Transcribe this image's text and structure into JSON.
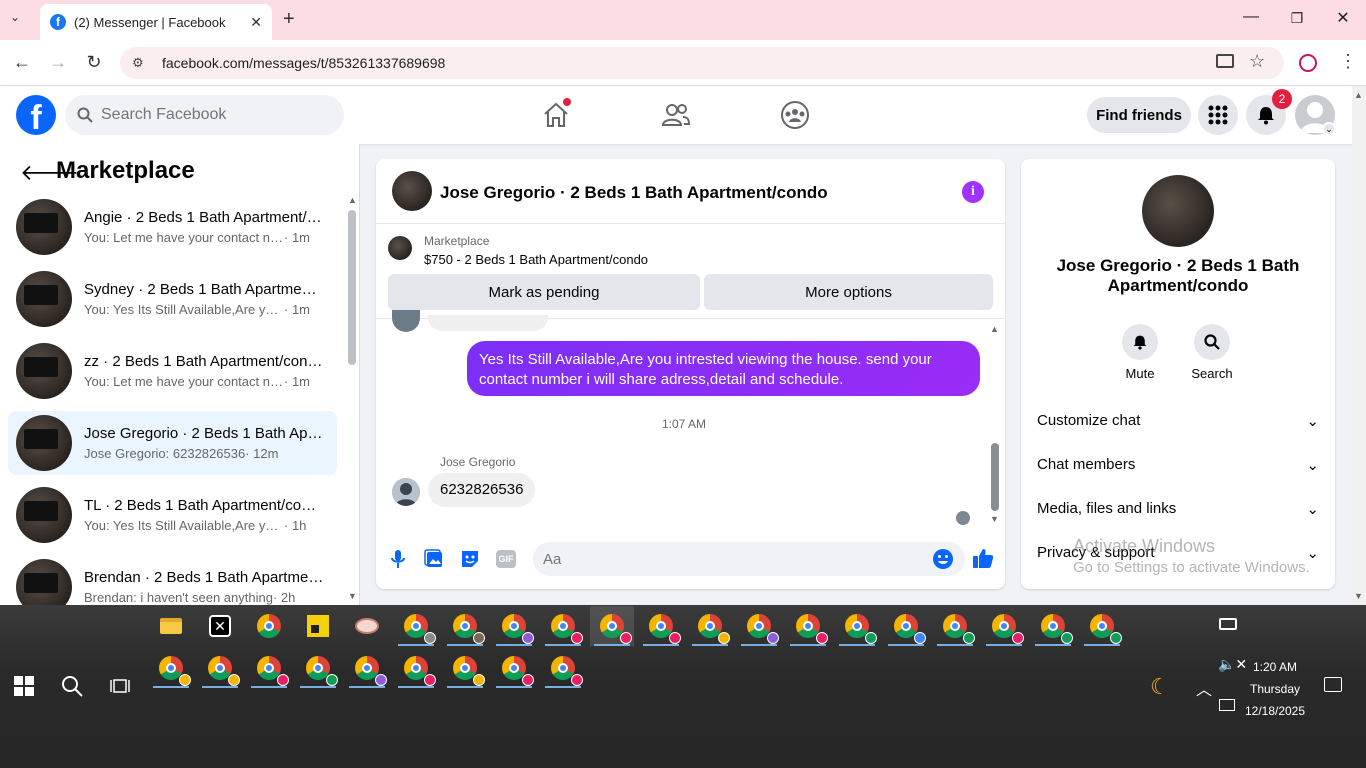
{
  "browser": {
    "tab_title": "(2) Messenger | Facebook",
    "url": "facebook.com/messages/t/853261337689698"
  },
  "header": {
    "search_placeholder": "Search Facebook",
    "find_friends": "Find friends",
    "notifications_count": "2"
  },
  "sidebar": {
    "title": "Marketplace",
    "conversations": [
      {
        "name": "Angie · 2 Beds 1 Bath Apartment/condo",
        "preview": "You: Let me have your contact number",
        "time": "· 1m",
        "selected": false
      },
      {
        "name": "Sydney · 2 Beds 1 Bath Apartment/condo",
        "preview": "You: Yes Its Still Available,Are you intrested",
        "time": "· 1m",
        "selected": false
      },
      {
        "name": "zz · 2 Beds 1 Bath Apartment/condo",
        "preview": "You: Let me have your contact number",
        "time": "· 1m",
        "selected": false
      },
      {
        "name": "Jose Gregorio · 2 Beds 1 Bath Apartment/condo",
        "preview": "Jose Gregorio: 6232826536",
        "time": " · 12m",
        "selected": true
      },
      {
        "name": "TL · 2 Beds 1 Bath Apartment/condo",
        "preview": "You: Yes Its Still Available,Are you intrested",
        "time": "· 1h",
        "selected": false
      },
      {
        "name": "Brendan · 2 Beds 1 Bath Apartment/condo",
        "preview": "Brendan: i haven't seen anything",
        "time": "· 2h",
        "selected": false
      }
    ]
  },
  "chat": {
    "title": "Jose Gregorio · 2 Beds 1 Bath Apartment/condo",
    "listing_label": "Marketplace",
    "listing_price": "$750 - 2 Beds 1 Bath Apartment/condo",
    "mark_pending": "Mark as pending",
    "more_options": "More options",
    "outgoing_message": "Yes Its Still Available,Are you intrested viewing the house. send your contact number i will share adress,detail and schedule.",
    "timestamp": "1:07 AM",
    "sender_name": "Jose Gregorio",
    "incoming_message": "6232826536",
    "input_placeholder": "Aa",
    "gif_label": "GIF"
  },
  "details": {
    "name": "Jose Gregorio · 2 Beds 1 Bath Apartment/condo",
    "mute": "Mute",
    "search": "Search",
    "sections": [
      "Customize chat",
      "Chat members",
      "Media, files and links",
      "Privacy & support"
    ]
  },
  "watermark": {
    "line1": "Activate Windows",
    "line2": "Go to Settings to activate Windows."
  },
  "taskbar": {
    "time": "1:20 AM",
    "day": "Thursday",
    "date": "12/18/2025"
  },
  "colors": {
    "fb_blue": "#0866ff",
    "messenger_purple": "#8a2cf6",
    "tabbar_pink": "#fbdde3"
  }
}
